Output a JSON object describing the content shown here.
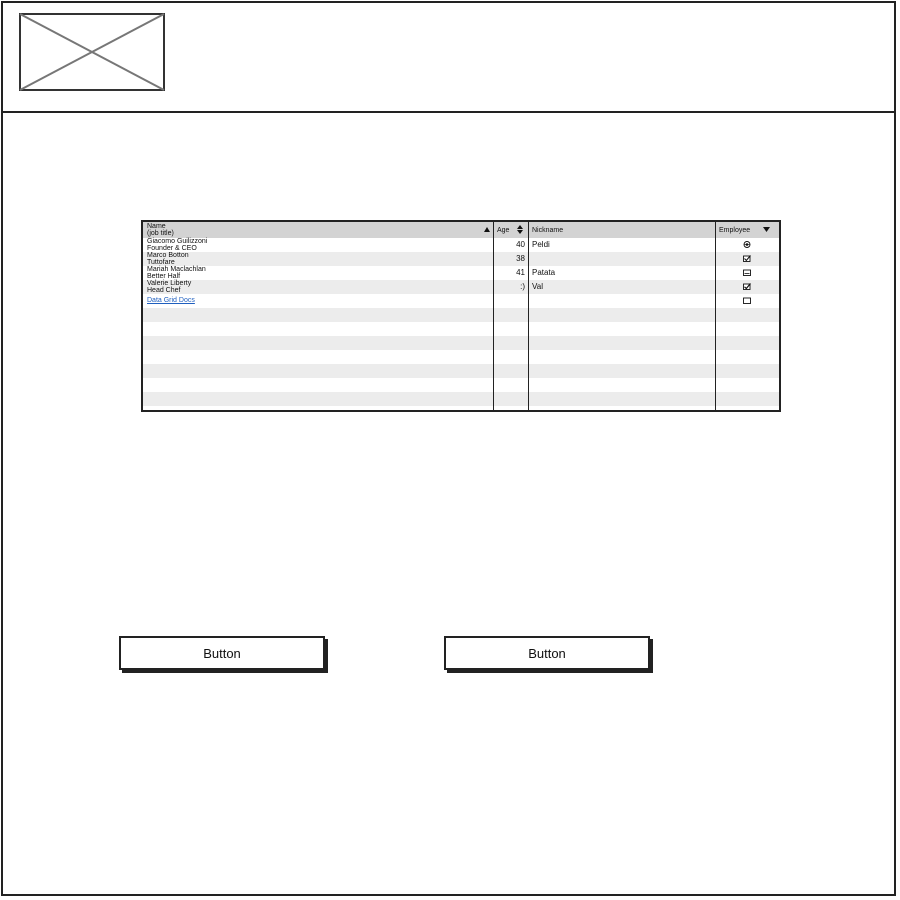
{
  "logo": {
    "icon": "image-placeholder-icon"
  },
  "grid": {
    "columns": [
      {
        "label_line1": "Name",
        "label_line2": "(job title)",
        "sort_icon": "sort-ascending-icon"
      },
      {
        "label": "Age",
        "sort_icon": "sort-both-icon"
      },
      {
        "label": "Nickname"
      },
      {
        "label": "Employee",
        "sort_icon": "sort-descending-icon"
      }
    ],
    "rows": [
      {
        "name": "Giacomo Guilizzoni",
        "title": "Founder & CEO",
        "age": "40",
        "nickname": "Peldi",
        "employee": "radio-selected-icon"
      },
      {
        "name": "Marco Botton",
        "title": "Tuttofare",
        "age": "38",
        "nickname": "",
        "employee": "checkbox-checked-icon"
      },
      {
        "name": "Mariah Maclachlan",
        "title": "Better Half",
        "age": "41",
        "nickname": "Patata",
        "employee": "checkbox-partial-icon"
      },
      {
        "name": "Valerie Liberty",
        "title": "Head Chef",
        "age": ":)",
        "nickname": "Val",
        "employee": "checkbox-checked-icon"
      }
    ],
    "link_row": {
      "label": "Data Grid Docs",
      "employee": "checkbox-empty-icon"
    }
  },
  "buttons": [
    {
      "label": "Button"
    },
    {
      "label": "Button"
    }
  ]
}
